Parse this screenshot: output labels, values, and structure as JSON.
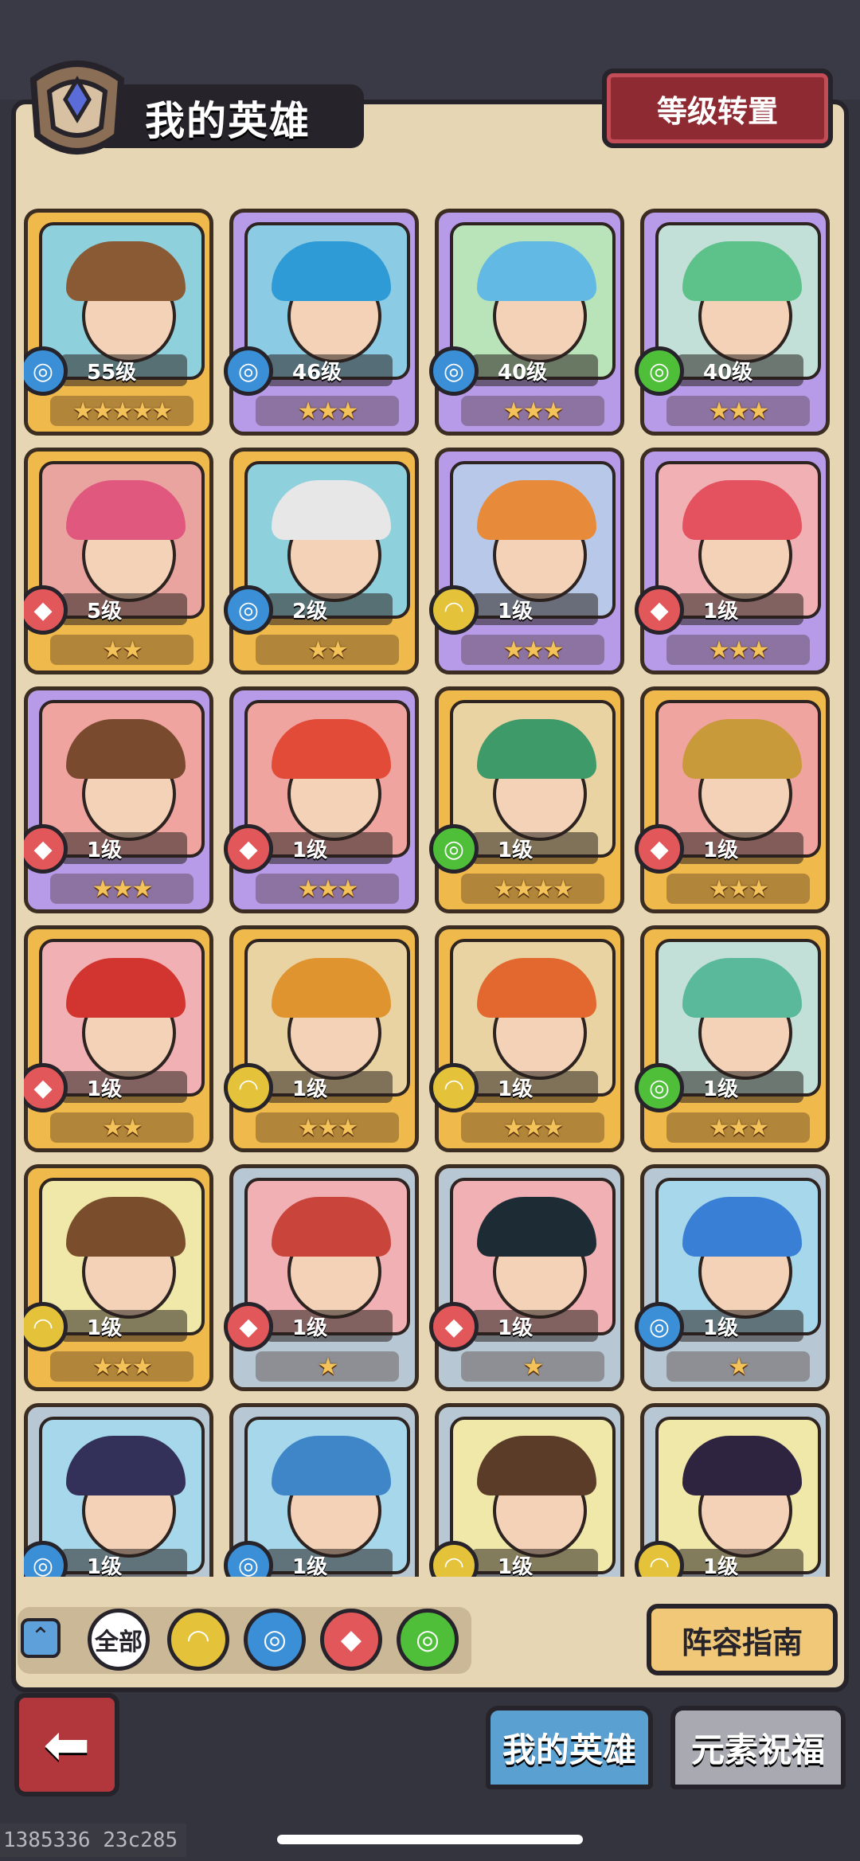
{
  "header": {
    "title": "我的英雄",
    "level_transfer_button": "等级转置"
  },
  "element_glyphs": {
    "water": "◎",
    "fire": "◆",
    "earth": "◠",
    "wind": "◎"
  },
  "colors": {
    "water": "#3a8fd6",
    "fire": "#e2585a",
    "earth": "#e4c23a",
    "wind": "#4fbf3a",
    "gold_frame": "#f0b94c",
    "purple_frame": "#b79be8",
    "silver_frame": "#b8c7d4"
  },
  "heroes": [
    {
      "level": "55级",
      "element": "water",
      "stars": "★★★★★",
      "frame": "gold",
      "bg": "#8fd0dd",
      "hair": "#8a5a34"
    },
    {
      "level": "46级",
      "element": "water",
      "stars": "★★★",
      "frame": "purple",
      "bg": "#8bcbe3",
      "hair": "#2f9bd6"
    },
    {
      "level": "40级",
      "element": "water",
      "stars": "★★★",
      "frame": "purple",
      "bg": "#b9e3b8",
      "hair": "#62b9e3"
    },
    {
      "level": "40级",
      "element": "wind",
      "stars": "★★★",
      "frame": "purple",
      "bg": "#c2e0d8",
      "hair": "#5cc28a"
    },
    {
      "level": "5级",
      "element": "fire",
      "stars": "★★",
      "frame": "gold",
      "bg": "#e9a4a0",
      "hair": "#e0587e"
    },
    {
      "level": "2级",
      "element": "water",
      "stars": "★★",
      "frame": "gold",
      "bg": "#8fd0dd",
      "hair": "#e7e7e7"
    },
    {
      "level": "1级",
      "element": "earth",
      "stars": "★★★",
      "frame": "purple",
      "bg": "#b8c8e8",
      "hair": "#e78b3a"
    },
    {
      "level": "1级",
      "element": "fire",
      "stars": "★★★",
      "frame": "purple",
      "bg": "#f0b0b4",
      "hair": "#e4525f"
    },
    {
      "level": "1级",
      "element": "fire",
      "stars": "★★★",
      "frame": "purple",
      "bg": "#f0a4a0",
      "hair": "#7a4a2f"
    },
    {
      "level": "1级",
      "element": "fire",
      "stars": "★★★",
      "frame": "purple",
      "bg": "#f0a4a0",
      "hair": "#e24b37"
    },
    {
      "level": "1级",
      "element": "wind",
      "stars": "★★★★",
      "frame": "gold",
      "bg": "#ead3a3",
      "hair": "#3f9a6a"
    },
    {
      "level": "1级",
      "element": "fire",
      "stars": "★★★",
      "frame": "gold",
      "bg": "#f0a4a0",
      "hair": "#c89a3a"
    },
    {
      "level": "1级",
      "element": "fire",
      "stars": "★★",
      "frame": "gold",
      "bg": "#f0b0b4",
      "hair": "#d2352f"
    },
    {
      "level": "1级",
      "element": "earth",
      "stars": "★★★",
      "frame": "gold",
      "bg": "#ead3a3",
      "hair": "#e0942f"
    },
    {
      "level": "1级",
      "element": "earth",
      "stars": "★★★",
      "frame": "gold",
      "bg": "#ead3a3",
      "hair": "#e2682f"
    },
    {
      "level": "1级",
      "element": "wind",
      "stars": "★★★",
      "frame": "gold",
      "bg": "#c2e0d8",
      "hair": "#59b99a"
    },
    {
      "level": "1级",
      "element": "earth",
      "stars": "★★★",
      "frame": "gold",
      "bg": "#f0e8a8",
      "hair": "#7a4e2c"
    },
    {
      "level": "1级",
      "element": "fire",
      "stars": "★",
      "frame": "silver",
      "bg": "#f0b0b4",
      "hair": "#c9453b"
    },
    {
      "level": "1级",
      "element": "fire",
      "stars": "★",
      "frame": "silver",
      "bg": "#f0b0b4",
      "hair": "#1d2b35"
    },
    {
      "level": "1级",
      "element": "water",
      "stars": "★",
      "frame": "silver",
      "bg": "#a6d7ea",
      "hair": "#3a7fd6"
    },
    {
      "level": "1级",
      "element": "water",
      "stars": "★",
      "frame": "silver",
      "bg": "#a6d7ea",
      "hair": "#33305a"
    },
    {
      "level": "1级",
      "element": "water",
      "stars": "★",
      "frame": "silver",
      "bg": "#a6d7ea",
      "hair": "#3f86c9"
    },
    {
      "level": "1级",
      "element": "earth",
      "stars": "★",
      "frame": "silver",
      "bg": "#f0e8a8",
      "hair": "#5a3c28"
    },
    {
      "level": "1级",
      "element": "earth",
      "stars": "★",
      "frame": "silver",
      "bg": "#f0e8a8",
      "hair": "#2e2440"
    }
  ],
  "filters": {
    "all_label": "全部",
    "items": [
      "earth",
      "water",
      "fire",
      "wind"
    ]
  },
  "lineup_guide_button": "阵容指南",
  "tabs": {
    "my_heroes": "我的英雄",
    "element_blessing": "元素祝福"
  },
  "debug_text": "1385336 23c285"
}
